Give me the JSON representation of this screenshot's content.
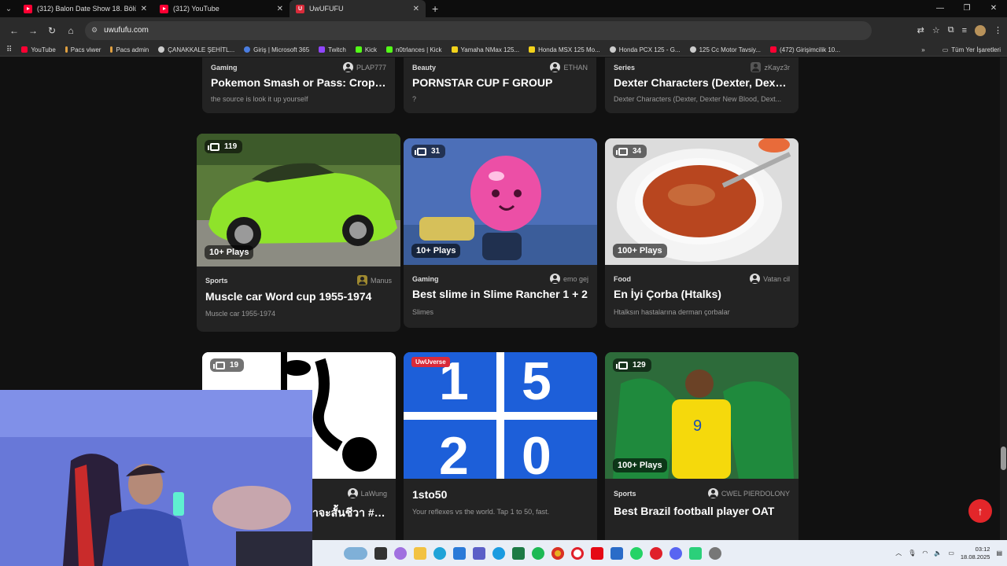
{
  "tabs": [
    {
      "title": "(312) Balon Date Show 18. Bölü",
      "icon": "youtube-icon"
    },
    {
      "title": "(312) YouTube",
      "icon": "youtube-icon"
    },
    {
      "title": "UwUFUFU",
      "icon": "uwufufu-icon"
    }
  ],
  "address": {
    "url": "uwufufu.com"
  },
  "bookmarks": [
    {
      "label": "YouTube",
      "color": "#ff0033"
    },
    {
      "label": "Pacs viwer",
      "color": "#e0a040"
    },
    {
      "label": "Pacs admin",
      "color": "#e0a040"
    },
    {
      "label": "ÇANAKKALE ŞEHİTL...",
      "color": "#cccccc"
    },
    {
      "label": "Giriş | Microsoft 365",
      "color": "#4a7de0"
    },
    {
      "label": "Twitch",
      "color": "#9146ff"
    },
    {
      "label": "Kick",
      "color": "#53fc18"
    },
    {
      "label": "n0trlances | Kick",
      "color": "#53fc18"
    },
    {
      "label": "Yamaha NMax 125...",
      "color": "#f2d21b"
    },
    {
      "label": "Honda MSX 125 Mo...",
      "color": "#f2d21b"
    },
    {
      "label": "Honda PCX 125 - G...",
      "color": "#cccccc"
    },
    {
      "label": "125 Cc Motor Tavsiy...",
      "color": "#cccccc"
    },
    {
      "label": "(472) Girişimcilik 10...",
      "color": "#ff0033"
    }
  ],
  "bookmarks_all": "Tüm Yer İşaretleri",
  "cards": [
    {
      "category": "Gaming",
      "author": "PLAP777",
      "title": "Pokemon Smash or Pass: Cropp...",
      "desc": "the source is look it up yourself"
    },
    {
      "category": "Beauty",
      "author": "ETHAN",
      "title": "PORNSTAR CUP F GROUP",
      "desc": "?"
    },
    {
      "category": "Series",
      "author": "zKayz3r",
      "title": "Dexter Characters (Dexter, Dexte...",
      "desc": "Dexter Characters (Dexter, Dexter New Blood, Dext..."
    },
    {
      "category": "Sports",
      "author": "Manus",
      "title": "Muscle car Word cup 1955-1974",
      "desc": "Muscle car 1955-1974",
      "count": "119",
      "plays": "10+ Plays"
    },
    {
      "category": "Gaming",
      "author": "emo gej",
      "title": "Best slime in Slime Rancher 1 + 2",
      "desc": "Slimes",
      "count": "31",
      "plays": "10+ Plays"
    },
    {
      "category": "Food",
      "author": "Vatan cil",
      "title": "En İyi Çorba (Htalks)",
      "desc": "Htalksın hastalarına derman çorbalar",
      "count": "34",
      "plays": "100+ Plays"
    },
    {
      "author": "LaWung",
      "title": "าจะสั้นชีวา #ส...",
      "count": "19"
    },
    {
      "badge": "UwUverse",
      "title": "1sto50",
      "desc": "Your reflexes vs the world. Tap 1 to 50, fast.",
      "grid": [
        "1",
        "5",
        "2",
        "0"
      ]
    },
    {
      "category": "Sports",
      "author": "CWEL PIERDOLONY",
      "title": "Best Brazil football player OAT",
      "count": "129",
      "plays": "100+ Plays"
    }
  ],
  "clock": {
    "time": "03:12",
    "date": "18.08.2025"
  },
  "fab": "↑",
  "colors": {
    "accent": "#e3262a",
    "card": "#232323",
    "bg": "#111111"
  }
}
